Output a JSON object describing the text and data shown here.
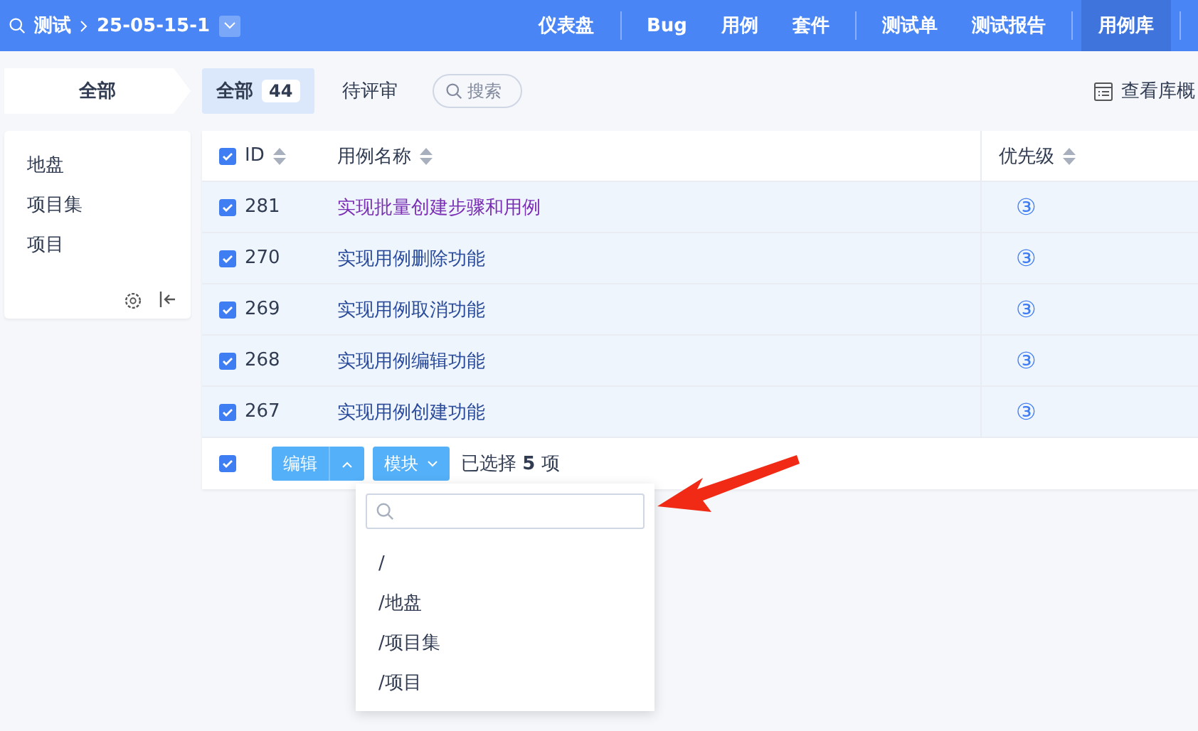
{
  "topbar": {
    "product": "测试",
    "breadcrumb": "25-05-15-1",
    "nav": [
      {
        "label": "仪表盘",
        "selected": false,
        "divider_after": true
      },
      {
        "label": "Bug",
        "selected": false,
        "divider_after": false
      },
      {
        "label": "用例",
        "selected": false,
        "divider_after": false
      },
      {
        "label": "套件",
        "selected": false,
        "divider_after": true
      },
      {
        "label": "测试单",
        "selected": false,
        "divider_after": false
      },
      {
        "label": "测试报告",
        "selected": false,
        "divider_after": true
      },
      {
        "label": "用例库",
        "selected": true,
        "divider_after": true
      }
    ]
  },
  "module_tab": "全部",
  "modules": [
    "地盘",
    "项目集",
    "项目"
  ],
  "filters": [
    {
      "label": "全部",
      "count": "44",
      "selected": true
    },
    {
      "label": "待评审",
      "selected": false
    }
  ],
  "search": {
    "placeholder": "搜索"
  },
  "overview_link": "查看库概",
  "table": {
    "columns": [
      "ID",
      "用例名称",
      "优先级"
    ],
    "header_checked": true,
    "rows": [
      {
        "id": "281",
        "name": "实现批量创建步骤和用例",
        "priority": "③",
        "checked": true,
        "visited": true
      },
      {
        "id": "270",
        "name": "实现用例删除功能",
        "priority": "③",
        "checked": true,
        "visited": false
      },
      {
        "id": "269",
        "name": "实现用例取消功能",
        "priority": "③",
        "checked": true,
        "visited": false
      },
      {
        "id": "268",
        "name": "实现用例编辑功能",
        "priority": "③",
        "checked": true,
        "visited": false
      },
      {
        "id": "267",
        "name": "实现用例创建功能",
        "priority": "③",
        "checked": true,
        "visited": false
      }
    ]
  },
  "footer": {
    "checked": true,
    "edit_button": "编辑",
    "module_button": "模块",
    "summary": "已选择 **5** 项"
  },
  "module_menu": {
    "items": [
      "/",
      "/地盘",
      "/项目集",
      "/项目"
    ]
  }
}
